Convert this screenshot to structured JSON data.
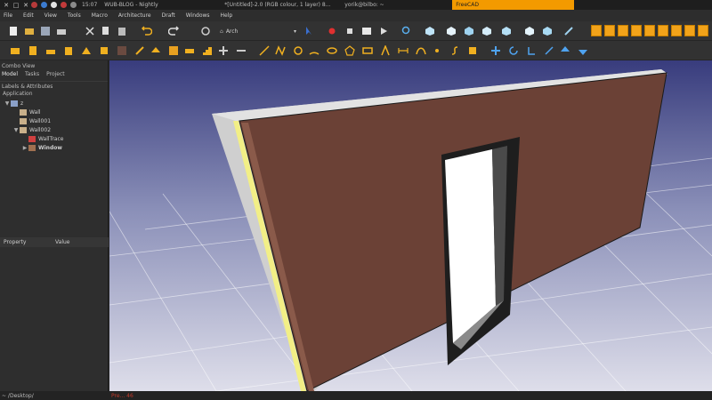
{
  "taskbar": {
    "time": "15:07",
    "items": [
      {
        "label": "WUB-BLOG - Nightly"
      },
      {
        "label": "*[Untitled]-2.0 (RGB colour, 1 layer) 8..."
      },
      {
        "label": "yorik@bilbo: ~"
      },
      {
        "label": "FreeCAD"
      }
    ]
  },
  "menubar": {
    "items": [
      "File",
      "Edit",
      "View",
      "Tools",
      "Macro",
      "Architecture",
      "Draft",
      "Windows",
      "Help"
    ]
  },
  "toolbar": {
    "workbench": "Arch"
  },
  "combo": {
    "title": "Combo View",
    "tabs": [
      "Model",
      "Tasks",
      "Project"
    ],
    "labels_header": "Labels & Attributes",
    "application": "Application",
    "tree": [
      {
        "label": "z",
        "indent": 0,
        "expander": "▼",
        "icon": "document-icon"
      },
      {
        "label": "Wall",
        "indent": 1,
        "expander": "",
        "icon": "wall-icon"
      },
      {
        "label": "Wall001",
        "indent": 1,
        "expander": "",
        "icon": "wall-icon"
      },
      {
        "label": "Wall002",
        "indent": 1,
        "expander": "▼",
        "icon": "wall-icon"
      },
      {
        "label": "WallTrace",
        "indent": 2,
        "expander": "",
        "icon": "sketch-icon"
      },
      {
        "label": "Window",
        "indent": 2,
        "expander": "▶",
        "icon": "window-icon",
        "bold": true
      }
    ],
    "property_header": [
      "Property",
      "Value"
    ]
  },
  "statusbar": {
    "left": "~ /Desktop/",
    "right": "Pre... 46"
  },
  "colors": {
    "accent": "#f39a00",
    "viewport_top": "#3a3e7e",
    "viewport_bottom": "#d9d9e6",
    "wall_face": "#6b4136",
    "wall_top": "#d8d8d8"
  }
}
